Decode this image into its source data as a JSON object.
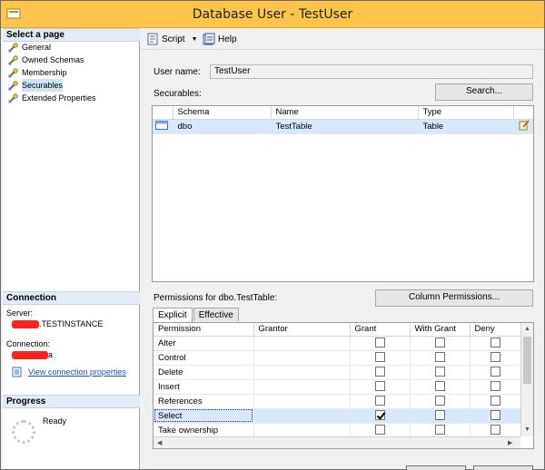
{
  "window": {
    "title": "Database User - TestUser"
  },
  "left": {
    "select_page_header": "Select a page",
    "pages": [
      {
        "label": "General",
        "selected": false
      },
      {
        "label": "Owned Schemas",
        "selected": false
      },
      {
        "label": "Membership",
        "selected": false
      },
      {
        "label": "Securables",
        "selected": true
      },
      {
        "label": "Extended Properties",
        "selected": false
      }
    ],
    "connection_header": "Connection",
    "server_label": "Server:",
    "server_value": ".TESTINSTANCE",
    "connection_label": "Connection:",
    "connection_value": "a",
    "view_connection_link": "View connection properties",
    "progress_header": "Progress",
    "progress_status": "Ready"
  },
  "toolbar": {
    "script_label": "Script",
    "help_label": "Help"
  },
  "form": {
    "user_name_label": "User name:",
    "user_name_value": "TestUser",
    "securables_label": "Securables:",
    "search_button": "Search...",
    "securables_columns": [
      "Schema",
      "Name",
      "Type"
    ],
    "securables_rows": [
      {
        "schema": "dbo",
        "name": "TestTable",
        "type": "Table"
      }
    ],
    "permissions_label": "Permissions for dbo.TestTable:",
    "column_permissions_button": "Column Permissions...",
    "tabs": [
      {
        "label": "Explicit",
        "active": true
      },
      {
        "label": "Effective",
        "active": false
      }
    ],
    "perm_columns": [
      "Permission",
      "Grantor",
      "Grant",
      "With Grant",
      "Deny"
    ],
    "perm_rows": [
      {
        "permission": "Alter",
        "grantor": "",
        "grant": false,
        "with_grant": false,
        "deny": false
      },
      {
        "permission": "Control",
        "grantor": "",
        "grant": false,
        "with_grant": false,
        "deny": false
      },
      {
        "permission": "Delete",
        "grantor": "",
        "grant": false,
        "with_grant": false,
        "deny": false
      },
      {
        "permission": "Insert",
        "grantor": "",
        "grant": false,
        "with_grant": false,
        "deny": false
      },
      {
        "permission": "References",
        "grantor": "",
        "grant": false,
        "with_grant": false,
        "deny": false
      },
      {
        "permission": "Select",
        "grantor": "",
        "grant": true,
        "with_grant": false,
        "deny": false
      },
      {
        "permission": "Take ownership",
        "grantor": "",
        "grant": false,
        "with_grant": false,
        "deny": false
      }
    ]
  }
}
